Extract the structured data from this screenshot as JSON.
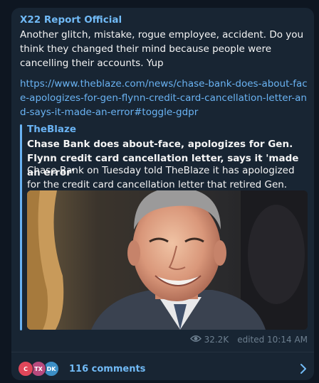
{
  "post": {
    "channel_name": "X22 Report Official",
    "text": "Another glitch, mistake, rogue employee, accident. Do you think they changed their mind because people were cancelling their accounts. Yup",
    "link": "https://www.theblaze.com/news/chase-bank-does-about-face-apologizes-for-gen-flynn-credit-card-cancellation-letter-and-says-it-made-an-error#toggle-gdpr"
  },
  "preview": {
    "site_name": "TheBlaze",
    "title": "Chase Bank does about-face, apologizes for Gen. Flynn credit card cancellation letter, says it 'made an error'",
    "description": "Chase Bank on Tuesday told TheBlaze it has apologized for the credit card cancellation letter that retired Gen. Michael Flynn — f..."
  },
  "meta": {
    "views": "32.2K",
    "edited_time": "edited 10:14 AM"
  },
  "comments": {
    "avatars": [
      {
        "initials": "C",
        "color": "#e0475a"
      },
      {
        "initials": "TX",
        "color": "#b84a7e"
      },
      {
        "initials": "DK",
        "color": "#3c8fc6"
      }
    ],
    "label": "116 comments"
  },
  "colors": {
    "background": "#0e1621",
    "bubble": "#182533",
    "accent": "#71baf6",
    "link": "#6ab3f3",
    "muted": "#6d7f8f"
  },
  "icons": {
    "views": "eye-icon",
    "open_comments": "chevron-right-icon"
  }
}
